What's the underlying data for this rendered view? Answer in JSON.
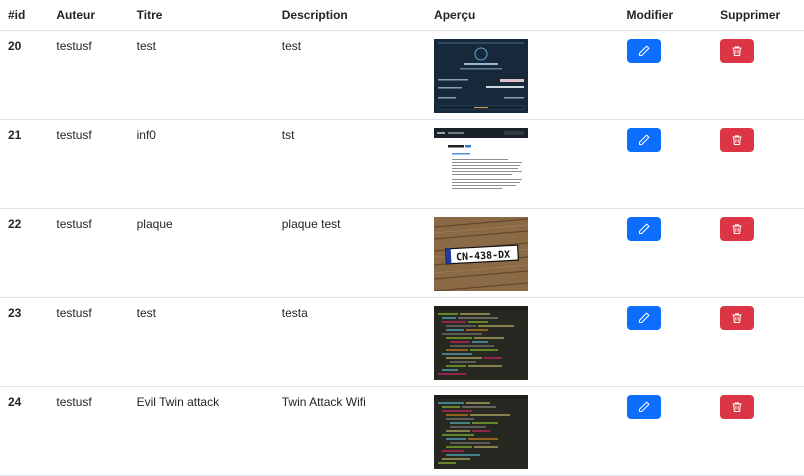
{
  "headers": {
    "id": "#id",
    "auteur": "Auteur",
    "titre": "Titre",
    "description": "Description",
    "apercu": "Aperçu",
    "modifier": "Modifier",
    "supprimer": "Supprimer"
  },
  "rows": [
    {
      "id": "20",
      "auteur": "testusf",
      "titre": "test",
      "description": "test",
      "preview": "dark-form"
    },
    {
      "id": "21",
      "auteur": "testusf",
      "titre": "inf0",
      "description": "tst",
      "preview": "document"
    },
    {
      "id": "22",
      "auteur": "testusf",
      "titre": "plaque",
      "description": "plaque test",
      "preview": "license-plate",
      "plate_text": "CN-438-DX"
    },
    {
      "id": "23",
      "auteur": "testusf",
      "titre": "test",
      "description": "testa",
      "preview": "code"
    },
    {
      "id": "24",
      "auteur": "testusf",
      "titre": "Evil Twin attack",
      "description": "Twin Attack Wifi",
      "preview": "code"
    }
  ],
  "icons": {
    "edit": "pencil-icon",
    "delete": "trash-icon"
  },
  "colors": {
    "edit_button": "#0d6efd",
    "delete_button": "#dc3545",
    "border": "#dee2e6"
  }
}
